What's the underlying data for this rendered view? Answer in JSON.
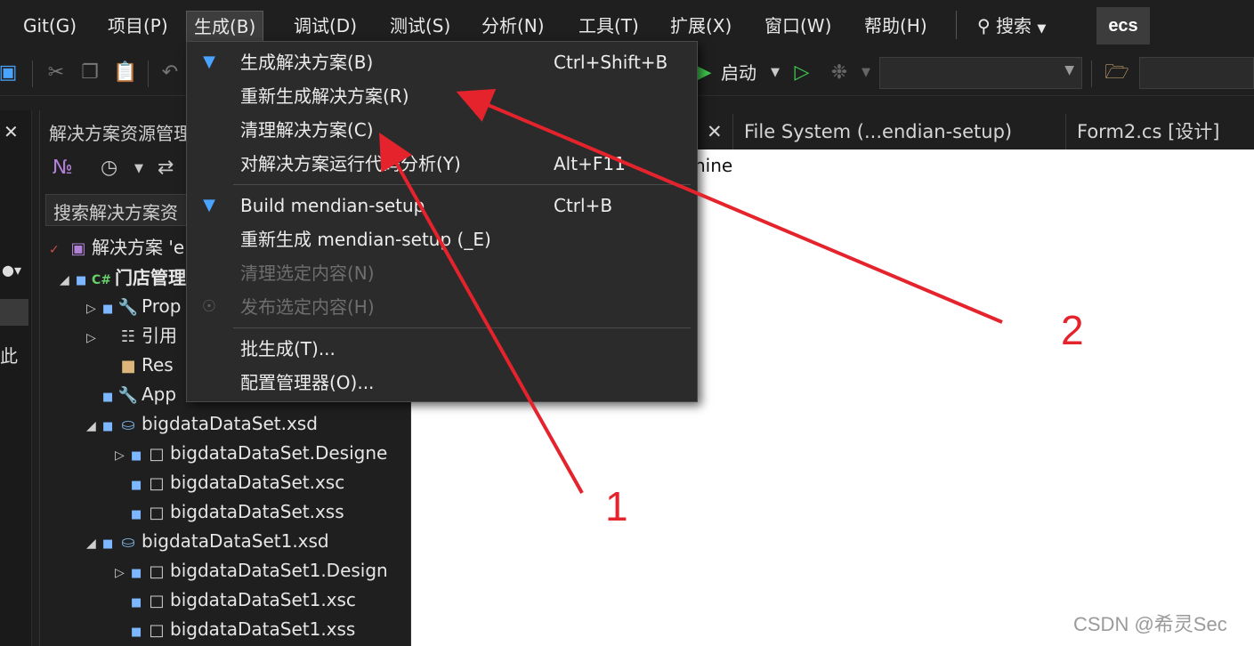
{
  "menubar": {
    "items": [
      "Git(G)",
      "项目(P)",
      "生成(B)",
      "调试(D)",
      "测试(S)",
      "分析(N)",
      "工具(T)",
      "扩展(X)",
      "窗口(W)",
      "帮助(H)"
    ],
    "search_label": "搜索",
    "account_badge": "ecs"
  },
  "toolbar": {
    "start_label": "启动"
  },
  "solution_explorer": {
    "title": "解决方案资源管理",
    "search_placeholder": "搜索解决方案资",
    "tree": [
      {
        "label": "解决方案 'e"
      },
      {
        "label": "门店管理"
      },
      {
        "label": "Prop"
      },
      {
        "label": "引用"
      },
      {
        "label": "Res"
      },
      {
        "label": "App"
      },
      {
        "label": "bigdataDataSet.xsd"
      },
      {
        "label": "bigdataDataSet.Designe"
      },
      {
        "label": "bigdataDataSet.xsc"
      },
      {
        "label": "bigdataDataSet.xss"
      },
      {
        "label": "bigdataDataSet1.xsd"
      },
      {
        "label": "bigdataDataSet1.Design"
      },
      {
        "label": "bigdataDataSet1.xsc"
      },
      {
        "label": "bigdataDataSet1.xss"
      }
    ]
  },
  "left_strip": {
    "text": "此"
  },
  "editor": {
    "tabs": [
      "File System (...endian-setup)",
      "Form2.cs [设计]"
    ],
    "visible_text": "hine"
  },
  "build_menu": {
    "items": [
      {
        "label": "生成解决方案(B)",
        "shortcut": "Ctrl+Shift+B",
        "icon": "build-icon"
      },
      {
        "label": "重新生成解决方案(R)",
        "shortcut": ""
      },
      {
        "label": "清理解决方案(C)",
        "shortcut": ""
      },
      {
        "label": "对解决方案运行代码分析(Y)",
        "shortcut": "Alt+F11"
      },
      {
        "label": "Build mendian-setup",
        "shortcut": "Ctrl+B",
        "icon": "build-icon"
      },
      {
        "label": "重新生成 mendian-setup (_E)",
        "shortcut": ""
      },
      {
        "label": "清理选定内容(N)",
        "shortcut": "",
        "disabled": true
      },
      {
        "label": "发布选定内容(H)",
        "shortcut": "",
        "disabled": true,
        "icon": "globe-icon"
      },
      {
        "label": "批生成(T)...",
        "shortcut": ""
      },
      {
        "label": "配置管理器(O)...",
        "shortcut": ""
      }
    ]
  },
  "annotations": {
    "label_1": "1",
    "label_2": "2",
    "color": "#e5232c"
  },
  "watermark": "CSDN @希灵Sec"
}
